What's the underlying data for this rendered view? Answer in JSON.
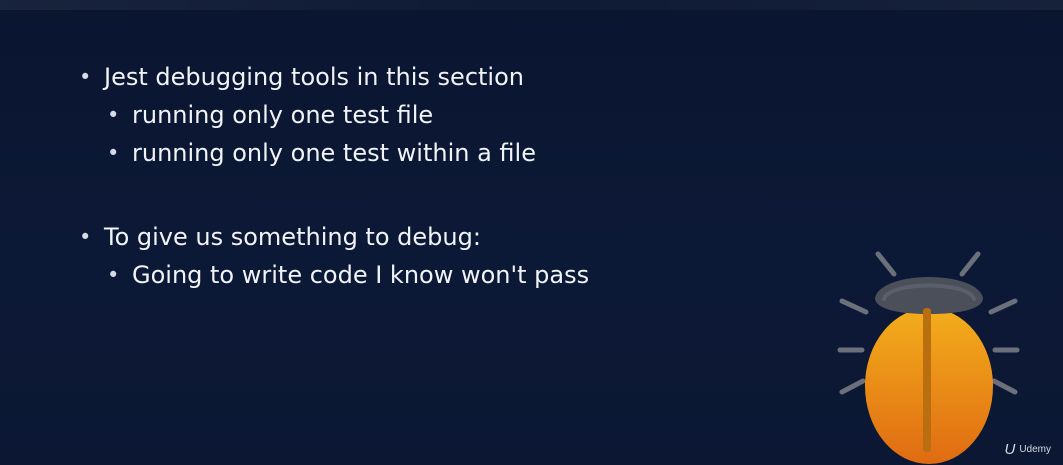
{
  "slide": {
    "groups": [
      {
        "title": "Jest debugging tools in this section",
        "items": [
          "running only one test file",
          "running only one test within a file"
        ]
      },
      {
        "title": "To give us something to debug:",
        "items": [
          "Going to write code I know won't pass"
        ]
      }
    ]
  },
  "illustration": {
    "icon": "bug-icon",
    "colors": {
      "shell_top": "#f3ae1c",
      "shell_bottom": "#e06b12",
      "head": "#4a4f59",
      "legs": "#6c707a",
      "stripe": "#b96e0f"
    }
  },
  "watermark": {
    "icon": "udemy-logo-icon",
    "text": "Udemy"
  }
}
